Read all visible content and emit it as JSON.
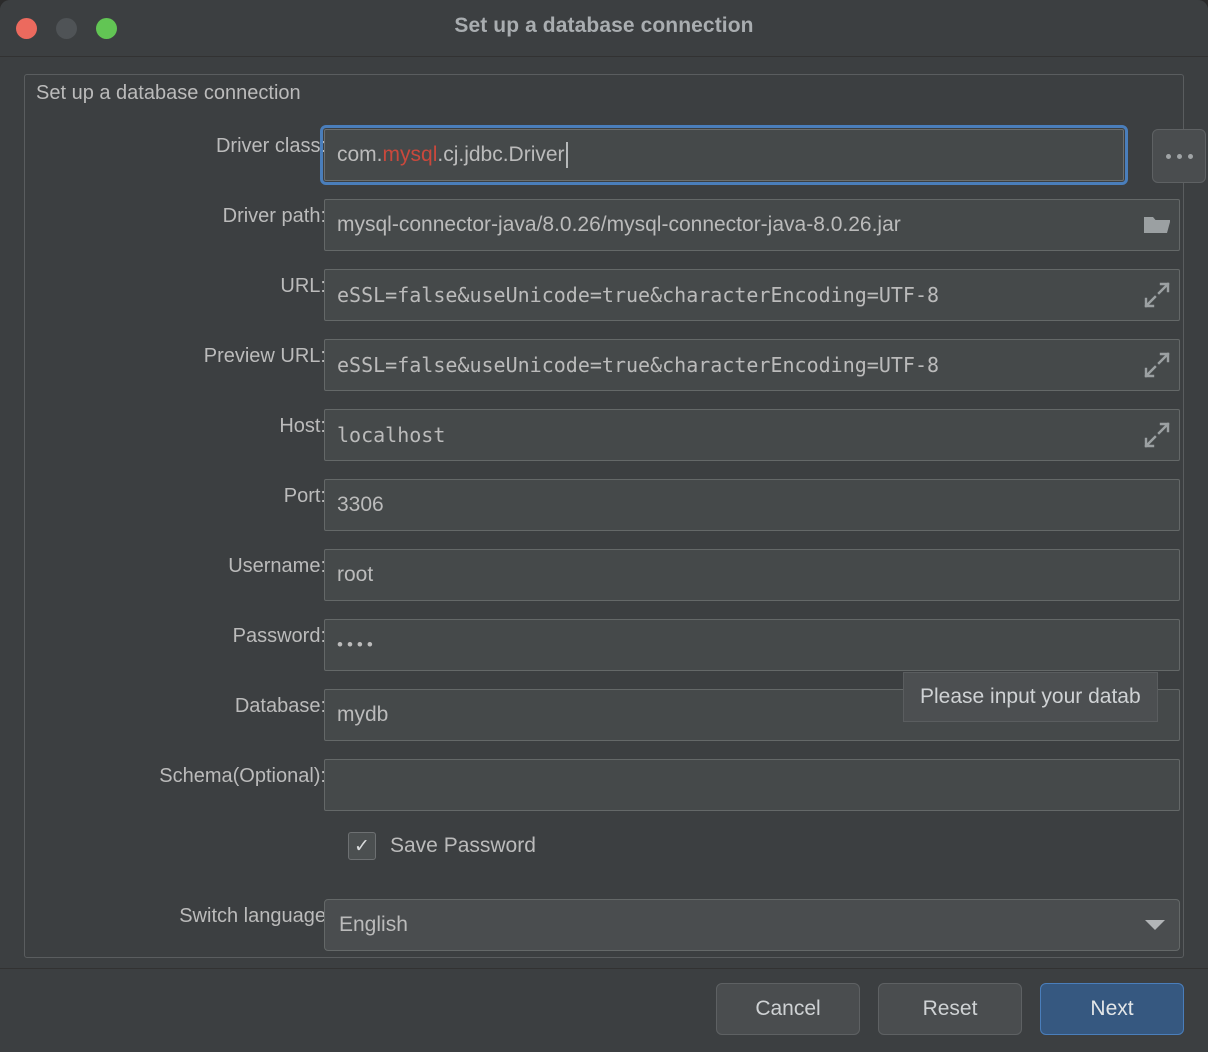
{
  "window": {
    "title": "Set up a database connection",
    "traffic_lights": [
      "close-red",
      "minimize-gray",
      "zoom-green"
    ]
  },
  "group": {
    "legend": "Set up a database connection"
  },
  "form": {
    "rows": [
      {
        "label": "Driver class:",
        "value_prefix": "com.",
        "value_highlight": "mysql",
        "value_suffix": ".cj.jdbc.Driver",
        "full_value": "com.mysql.cj.jdbc.Driver",
        "focused": true,
        "caret": true,
        "trailing_button": "ellipsis-button",
        "trailing_button_label": "..."
      },
      {
        "label": "Driver path:",
        "value": "mysql-connector-java/8.0.26/mysql-connector-java-8.0.26.jar",
        "inner_icon": "folder-icon"
      },
      {
        "label": "URL:",
        "value": "eSSL=false&useUnicode=true&characterEncoding=UTF-8",
        "inner_icon": "expand-icon"
      },
      {
        "label": "Preview URL:",
        "value": "eSSL=false&useUnicode=true&characterEncoding=UTF-8",
        "inner_icon": "expand-icon"
      },
      {
        "label": "Host:",
        "value": "localhost",
        "inner_icon": "expand-icon"
      },
      {
        "label": "Port:",
        "value": "3306",
        "inner_icon": null
      },
      {
        "label": "Username:",
        "value": "root",
        "inner_icon": null
      },
      {
        "label": "Password:",
        "value": "••••",
        "inner_icon": null
      },
      {
        "label": "Database:",
        "value": "mydb",
        "inner_icon": null
      },
      {
        "label": "Schema(Optional):",
        "value": "",
        "inner_icon": null
      }
    ],
    "save_password": {
      "label": "Save Password",
      "checked": true,
      "check_glyph": "✓"
    },
    "switch_language": {
      "label": "Switch language",
      "selected": "English"
    }
  },
  "tooltip": {
    "text": "Please input your datab"
  },
  "footer": {
    "cancel_label": "Cancel",
    "reset_label": "Reset",
    "next_label": "Next"
  },
  "colors": {
    "window_bg": "#3c3f41",
    "field_bg": "#45494a",
    "accent_blue": "#4a7ebb",
    "primary_btn_bg": "#365880",
    "text": "#bbbbbb",
    "error_red": "#c9483c",
    "traffic_red": "#ec6a5e",
    "traffic_yellow": "#4f5356",
    "traffic_green": "#62c554"
  }
}
